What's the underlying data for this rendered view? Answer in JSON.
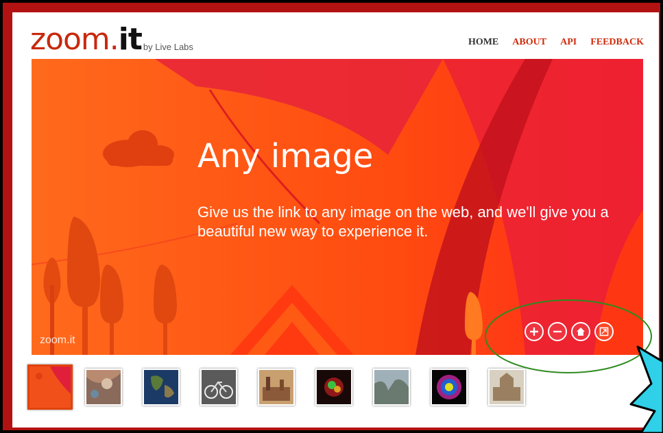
{
  "logo": {
    "main": "zoom.",
    "bold": "it",
    "by": "by Live Labs"
  },
  "nav": {
    "home": "HOME",
    "about": "ABOUT",
    "api": "API",
    "feedback": "FEEDBACK"
  },
  "hero": {
    "headline": "Any image",
    "subtext": "Give us the link to any image on the web, and we'll give you a beautiful new way to experience it.",
    "watermark": "zoom.it"
  },
  "controls": [
    "zoom-in-icon",
    "zoom-out-icon",
    "home-icon",
    "fullscreen-icon"
  ],
  "thumbnails": [
    {
      "name": "thumb-any-image",
      "selected": true,
      "color": "#f2501a"
    },
    {
      "name": "thumb-abstract-painting",
      "selected": false,
      "color": "#a88068"
    },
    {
      "name": "thumb-earth",
      "selected": false,
      "color": "#28456a"
    },
    {
      "name": "thumb-bicycle",
      "selected": false,
      "color": "#707070"
    },
    {
      "name": "thumb-old-map",
      "selected": false,
      "color": "#b89060"
    },
    {
      "name": "thumb-galaxy-graph",
      "selected": false,
      "color": "#301010"
    },
    {
      "name": "thumb-yosemite",
      "selected": false,
      "color": "#8aa0a8"
    },
    {
      "name": "thumb-mandala",
      "selected": false,
      "color": "#2a0a3a"
    },
    {
      "name": "thumb-temple",
      "selected": false,
      "color": "#b8a078"
    }
  ],
  "colors": {
    "accent": "#d02c0c",
    "frame": "#b31212",
    "highlight_ellipse": "#2e8b1e",
    "callout": "#2fd0e8"
  }
}
